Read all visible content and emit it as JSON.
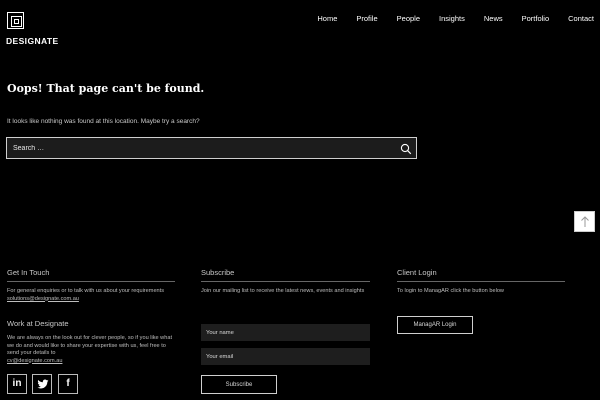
{
  "header": {
    "logo_text": "DESIGNATE",
    "nav": [
      "Home",
      "Profile",
      "People",
      "Insights",
      "News",
      "Portfolio",
      "Contact"
    ]
  },
  "main": {
    "title": "Oops! That page can't be found.",
    "message": "It looks like nothing was found at this location. Maybe try a search?",
    "search": {
      "placeholder": "Search …",
      "value": ""
    }
  },
  "footer": {
    "get_in_touch": {
      "heading": "Get In Touch",
      "text": "For general enquiries or to talk with us about your requirements",
      "email": "solutions@designate.com.au"
    },
    "work": {
      "heading": "Work at Designate",
      "text": "We are always on the look out for clever people, so if you like what we do and would like to share your expertise with us, feel free to send your details to",
      "email": "cv@designate.com.au"
    },
    "subscribe": {
      "heading": "Subscribe",
      "text": "Join our mailing list to receive the latest news, events and insights",
      "name_placeholder": "Your name",
      "email_placeholder": "Your email",
      "button": "Subscribe"
    },
    "client_login": {
      "heading": "Client Login",
      "text": "To login to ManagAR click the button below",
      "button": "ManagAR Login"
    },
    "social": {
      "linkedin": "in",
      "twitter_icon": "twitter-icon",
      "facebook": "f"
    }
  }
}
